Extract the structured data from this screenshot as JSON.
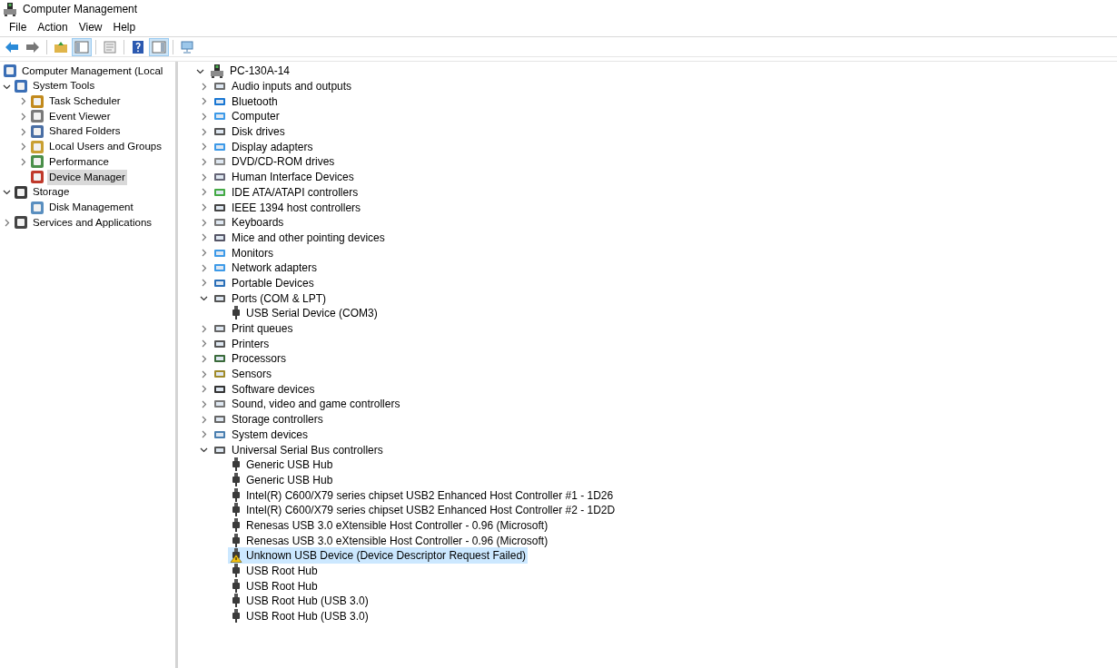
{
  "window": {
    "title": "Computer Management"
  },
  "menu": [
    "File",
    "Action",
    "View",
    "Help"
  ],
  "toolbar": [
    {
      "kind": "button",
      "pressed": false
    },
    {
      "kind": "button",
      "pressed": false
    },
    {
      "kind": "separator"
    },
    {
      "kind": "button",
      "pressed": false
    },
    {
      "kind": "button",
      "pressed": true
    },
    {
      "kind": "separator"
    },
    {
      "kind": "button",
      "pressed": false
    },
    {
      "kind": "separator"
    },
    {
      "kind": "button",
      "pressed": false
    },
    {
      "kind": "button",
      "pressed": true
    },
    {
      "kind": "separator"
    },
    {
      "kind": "button",
      "pressed": false
    }
  ],
  "nav_tree": [
    {
      "label": "Computer Management (Local",
      "selected": false,
      "children": [
        {
          "label": "System Tools",
          "expanded": true,
          "selected": false,
          "children": [
            {
              "label": "Task Scheduler",
              "expanded": false,
              "selected": false
            },
            {
              "label": "Event Viewer",
              "expanded": false,
              "selected": false
            },
            {
              "label": "Shared Folders",
              "expanded": false,
              "selected": false
            },
            {
              "label": "Local Users and Groups",
              "expanded": false,
              "selected": false
            },
            {
              "label": "Performance",
              "expanded": false,
              "selected": false
            },
            {
              "label": "Device Manager",
              "selected": true
            }
          ]
        },
        {
          "label": "Storage",
          "expanded": true,
          "selected": false,
          "children": [
            {
              "label": "Disk Management",
              "selected": false
            }
          ]
        },
        {
          "label": "Services and Applications",
          "expanded": false,
          "selected": false
        }
      ]
    }
  ],
  "device_tree": {
    "label": "PC-130A-14",
    "expanded": true,
    "children": [
      {
        "label": "Audio inputs and outputs",
        "expanded": false
      },
      {
        "label": "Bluetooth",
        "expanded": false
      },
      {
        "label": "Computer",
        "expanded": false
      },
      {
        "label": "Disk drives",
        "expanded": false
      },
      {
        "label": "Display adapters",
        "expanded": false
      },
      {
        "label": "DVD/CD-ROM drives",
        "expanded": false
      },
      {
        "label": "Human Interface Devices",
        "expanded": false
      },
      {
        "label": "IDE ATA/ATAPI controllers",
        "expanded": false
      },
      {
        "label": "IEEE 1394 host controllers",
        "expanded": false
      },
      {
        "label": "Keyboards",
        "expanded": false
      },
      {
        "label": "Mice and other pointing devices",
        "expanded": false
      },
      {
        "label": "Monitors",
        "expanded": false
      },
      {
        "label": "Network adapters",
        "expanded": false
      },
      {
        "label": "Portable Devices",
        "expanded": false
      },
      {
        "label": "Ports (COM & LPT)",
        "expanded": true,
        "children": [
          {
            "label": "USB Serial Device (COM3)",
            "warning": false,
            "selected": false
          }
        ]
      },
      {
        "label": "Print queues",
        "expanded": false
      },
      {
        "label": "Printers",
        "expanded": false
      },
      {
        "label": "Processors",
        "expanded": false
      },
      {
        "label": "Sensors",
        "expanded": false
      },
      {
        "label": "Software devices",
        "expanded": false
      },
      {
        "label": "Sound, video and game controllers",
        "expanded": false
      },
      {
        "label": "Storage controllers",
        "expanded": false
      },
      {
        "label": "System devices",
        "expanded": false
      },
      {
        "label": "Universal Serial Bus controllers",
        "expanded": true,
        "children": [
          {
            "label": "Generic USB Hub",
            "warning": false,
            "selected": false
          },
          {
            "label": "Generic USB Hub",
            "warning": false,
            "selected": false
          },
          {
            "label": "Intel(R) C600/X79 series chipset USB2 Enhanced Host Controller #1 - 1D26",
            "warning": false,
            "selected": false
          },
          {
            "label": "Intel(R) C600/X79 series chipset USB2 Enhanced Host Controller #2 - 1D2D",
            "warning": false,
            "selected": false
          },
          {
            "label": "Renesas USB 3.0 eXtensible Host Controller - 0.96 (Microsoft)",
            "warning": false,
            "selected": false
          },
          {
            "label": "Renesas USB 3.0 eXtensible Host Controller - 0.96 (Microsoft)",
            "warning": false,
            "selected": false
          },
          {
            "label": "Unknown USB Device (Device Descriptor Request Failed)",
            "warning": true,
            "selected": true
          },
          {
            "label": "USB Root Hub",
            "warning": false,
            "selected": false
          },
          {
            "label": "USB Root Hub",
            "warning": false,
            "selected": false
          },
          {
            "label": "USB Root Hub (USB 3.0)",
            "warning": false,
            "selected": false
          },
          {
            "label": "USB Root Hub (USB 3.0)",
            "warning": false,
            "selected": false
          }
        ]
      }
    ]
  }
}
